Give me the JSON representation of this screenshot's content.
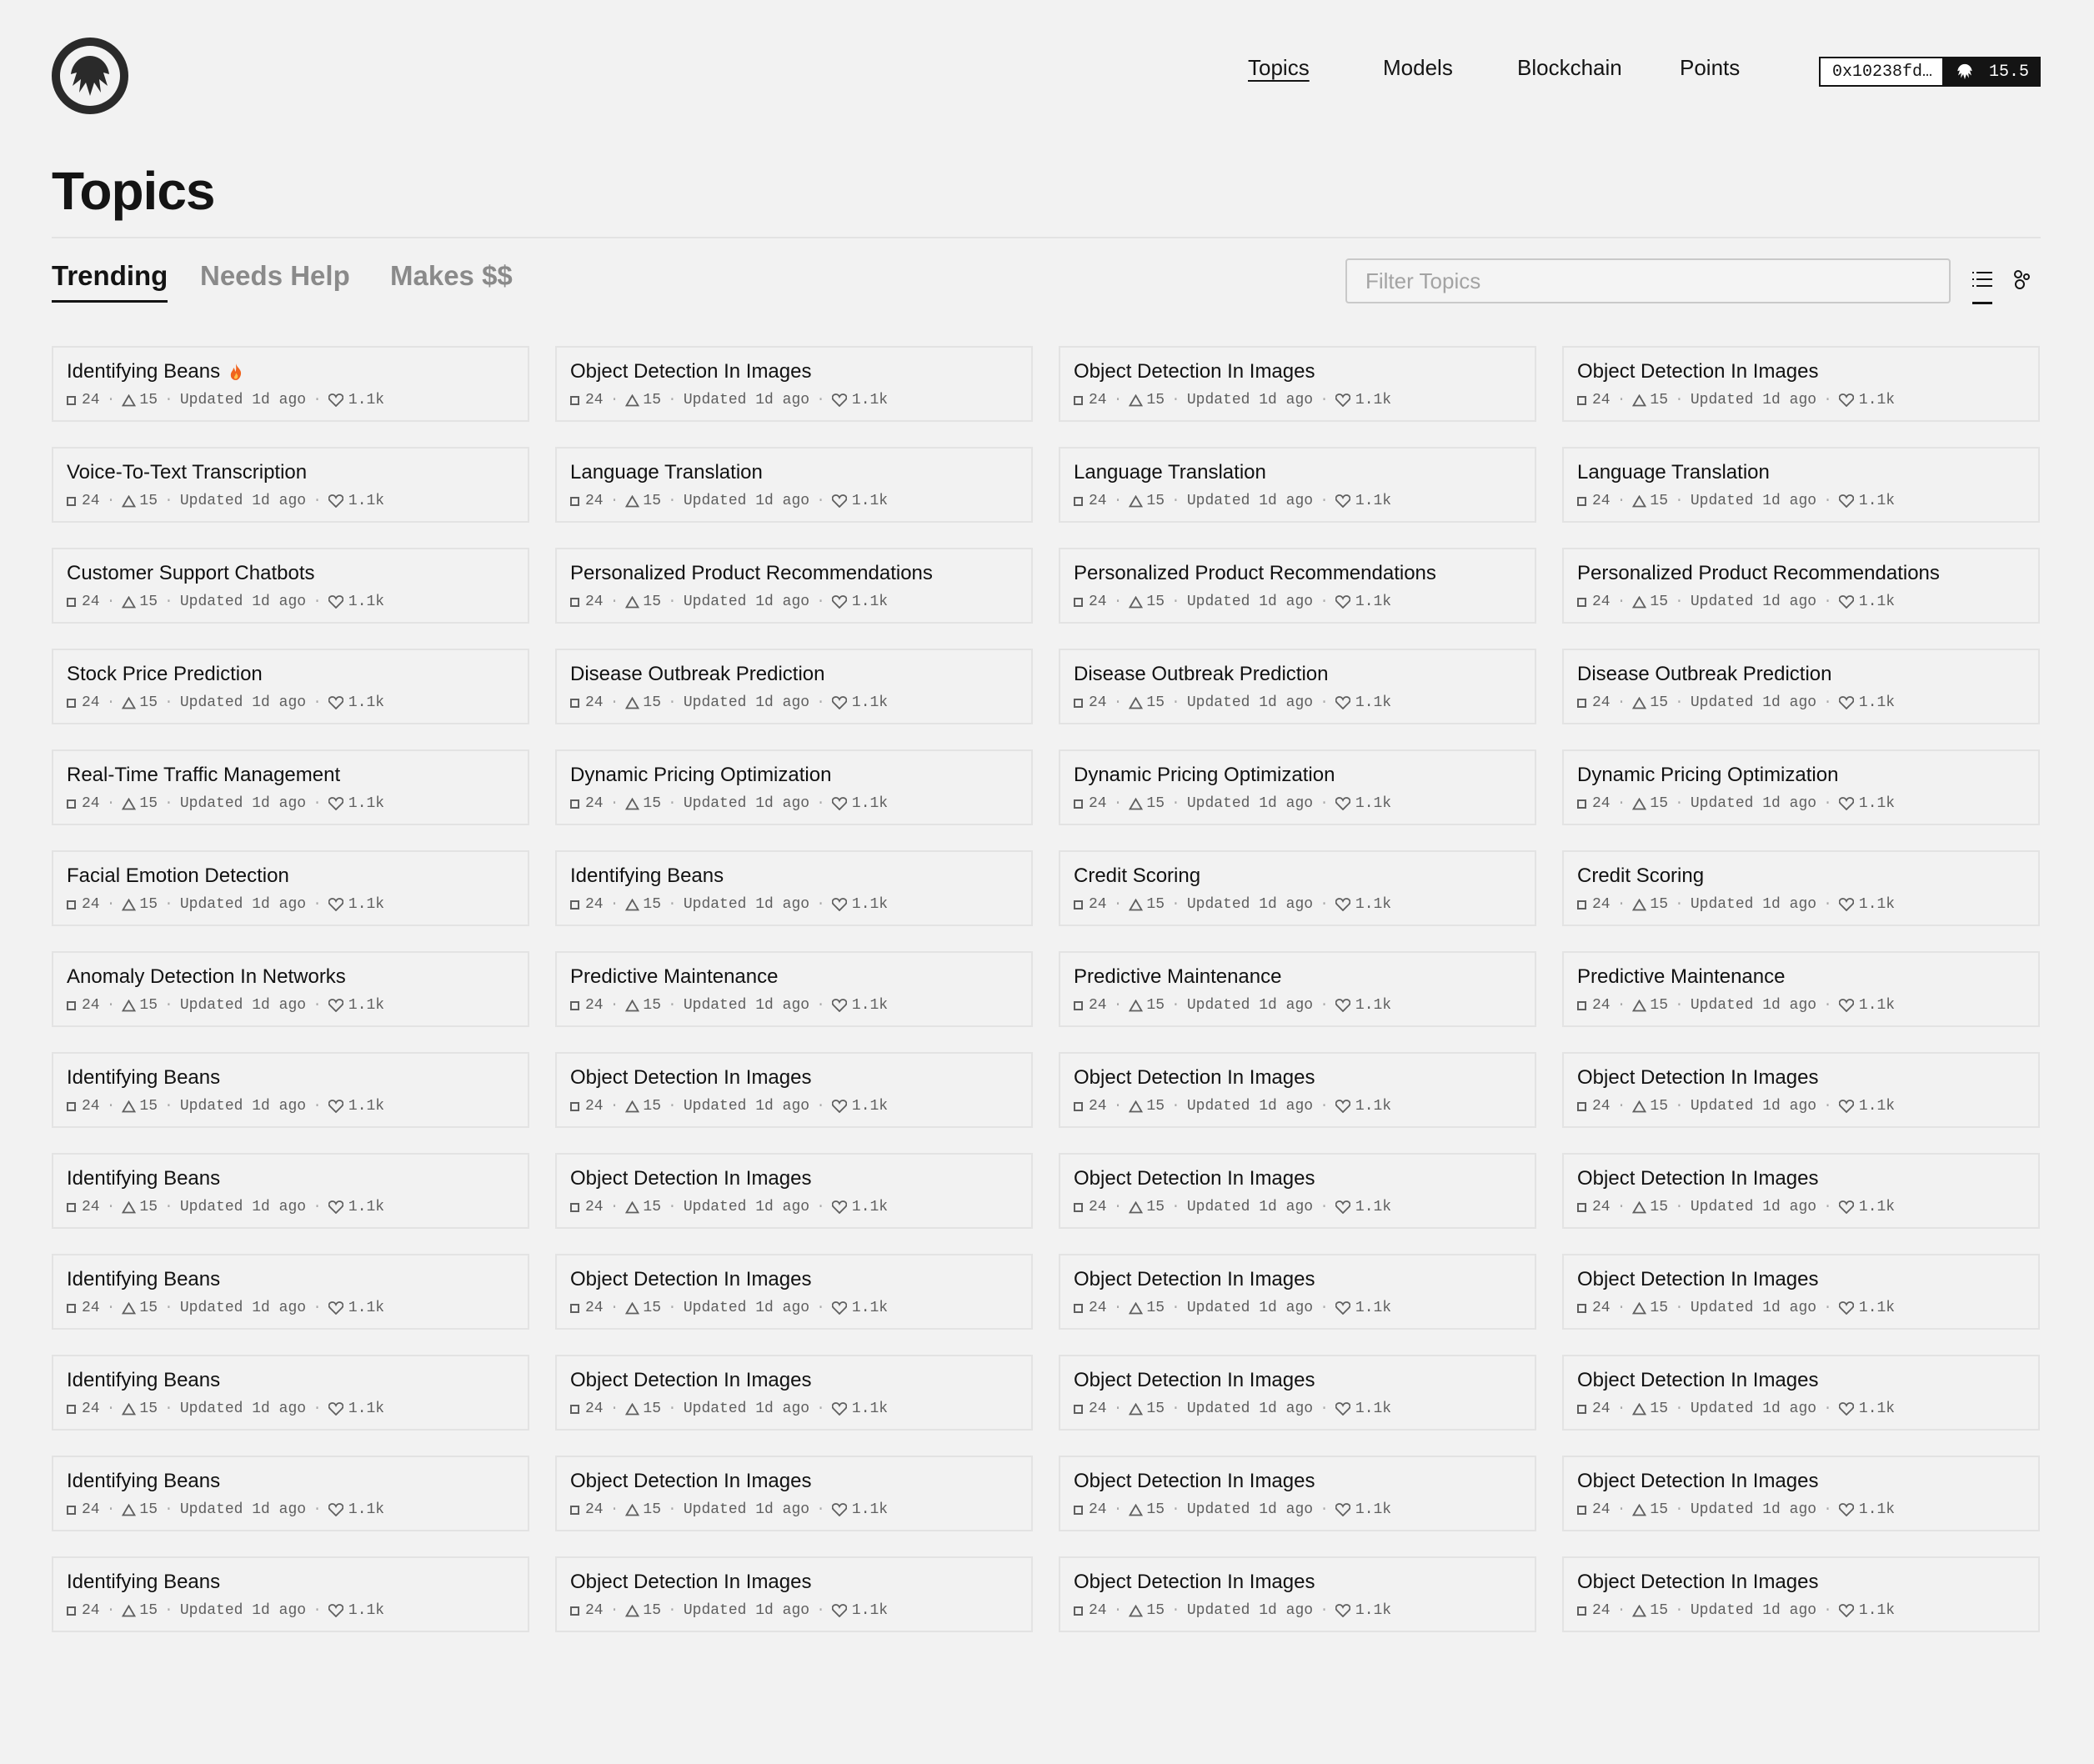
{
  "header": {
    "nav": [
      {
        "label": "Topics",
        "active": true
      },
      {
        "label": "Models",
        "active": false
      },
      {
        "label": "Blockchain",
        "active": false
      },
      {
        "label": "Points",
        "active": false
      }
    ],
    "wallet": {
      "address": "0x10238fd…",
      "balance": "15.5",
      "icon": "hand-logo-icon"
    }
  },
  "page": {
    "title": "Topics"
  },
  "tabs": [
    {
      "label": "Trending",
      "active": true
    },
    {
      "label": "Needs Help",
      "active": false
    },
    {
      "label": "Makes $$",
      "active": false
    }
  ],
  "filter": {
    "placeholder": "Filter Topics",
    "value": ""
  },
  "views": {
    "list_icon": "list-icon",
    "grid_icon": "bubbles-icon",
    "active": "list"
  },
  "card_meta": {
    "count_a": "24",
    "count_b": "15",
    "updated": "Updated 1d ago",
    "likes": "1.1k"
  },
  "topics": [
    [
      "Identifying Beans",
      "Object Detection In Images",
      "Object Detection In Images",
      "Object Detection In Images"
    ],
    [
      "Voice-To-Text Transcription",
      "Language Translation",
      "Language Translation",
      "Language Translation"
    ],
    [
      "Customer Support Chatbots",
      "Personalized Product Recommendations",
      "Personalized Product Recommendations",
      "Personalized Product Recommendations"
    ],
    [
      "Stock Price Prediction",
      "Disease Outbreak Prediction",
      "Disease Outbreak Prediction",
      "Disease Outbreak Prediction"
    ],
    [
      "Real-Time Traffic Management",
      "Dynamic Pricing Optimization",
      "Dynamic Pricing Optimization",
      "Dynamic Pricing Optimization"
    ],
    [
      "Facial Emotion Detection",
      "Identifying Beans",
      "Credit Scoring",
      "Credit Scoring"
    ],
    [
      "Anomaly Detection In Networks",
      "Predictive Maintenance",
      "Predictive Maintenance",
      "Predictive Maintenance"
    ],
    [
      "Identifying Beans",
      "Object Detection In Images",
      "Object Detection In Images",
      "Object Detection In Images"
    ],
    [
      "Identifying Beans",
      "Object Detection In Images",
      "Object Detection In Images",
      "Object Detection In Images"
    ],
    [
      "Identifying Beans",
      "Object Detection In Images",
      "Object Detection In Images",
      "Object Detection In Images"
    ],
    [
      "Identifying Beans",
      "Object Detection In Images",
      "Object Detection In Images",
      "Object Detection In Images"
    ],
    [
      "Identifying Beans",
      "Object Detection In Images",
      "Object Detection In Images",
      "Object Detection In Images"
    ],
    [
      "Identifying Beans",
      "Object Detection In Images",
      "Object Detection In Images",
      "Object Detection In Images"
    ]
  ],
  "hot_badge": {
    "icon": "fire-icon",
    "color": "#f0641e"
  }
}
